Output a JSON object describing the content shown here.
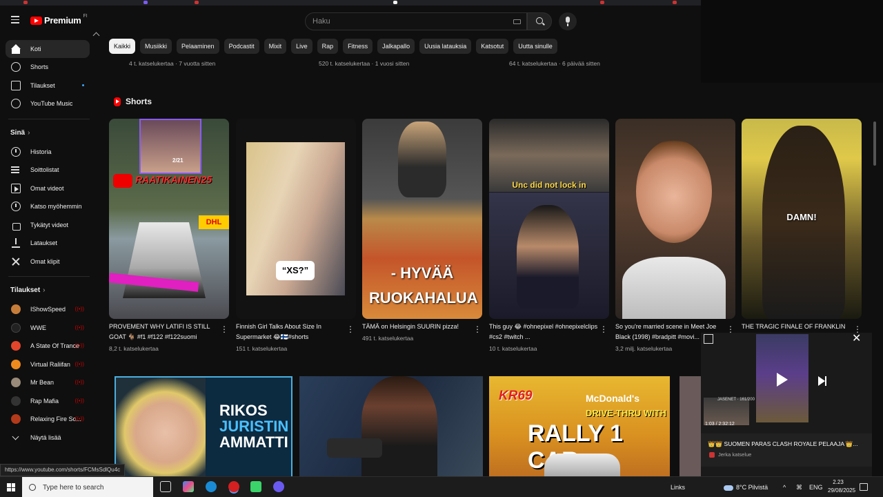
{
  "header": {
    "logo_text": "Premium",
    "logo_sup": "FI",
    "search_placeholder": "Haku"
  },
  "sidebar": {
    "main": [
      {
        "label": "Koti",
        "icon": "home-icon"
      },
      {
        "label": "Shorts",
        "icon": "shorts-icon"
      },
      {
        "label": "Tilaukset",
        "icon": "subscriptions-icon"
      },
      {
        "label": "YouTube Music",
        "icon": "music-icon"
      }
    ],
    "you_title": "Sinä",
    "you": [
      {
        "label": "Historia",
        "icon": "history-icon"
      },
      {
        "label": "Soittolistat",
        "icon": "playlists-icon"
      },
      {
        "label": "Omat videot",
        "icon": "your-videos-icon"
      },
      {
        "label": "Katso myöhemmin",
        "icon": "watch-later-icon"
      },
      {
        "label": "Tykätyt videot",
        "icon": "liked-icon"
      },
      {
        "label": "Lataukset",
        "icon": "downloads-icon"
      },
      {
        "label": "Omat klipit",
        "icon": "clips-icon"
      }
    ],
    "subs_title": "Tilaukset",
    "subs": [
      {
        "label": "IShowSpeed",
        "color": "#c77d3a"
      },
      {
        "label": "WWE",
        "color": "#222222"
      },
      {
        "label": "A State Of Trance",
        "color": "#e4452b"
      },
      {
        "label": "Virtual Raliifan",
        "color": "#f08a1f"
      },
      {
        "label": "Mr Bean",
        "color": "#9a8a7a"
      },
      {
        "label": "Rap Mafia",
        "color": "#333333"
      },
      {
        "label": "Relaxing Fire So...",
        "color": "#b33a1a"
      }
    ],
    "show_more": "Näytä lisää"
  },
  "chips": [
    "Kaikki",
    "Musiikki",
    "Pelaaminen",
    "Podcastit",
    "Mixit",
    "Live",
    "Rap",
    "Fitness",
    "Jalkapallo",
    "Uusia latauksia",
    "Katsotut",
    "Uutta sinulle"
  ],
  "top_meta": [
    "4 t. katselukertaa · 7 vuotta sitten",
    "520 t. katselukertaa · 1 vuosi sitten",
    "64 t. katselukertaa · 6 päivää sitten"
  ],
  "shorts_title": "Shorts",
  "shorts": [
    {
      "title": "PROVEMENT WHY LATIFI IS STILL GOAT 🐐 #f1 #f122 #f122suomi",
      "views": "8,2 t. katselukertaa",
      "overlay": "RAATIKAINEN25",
      "counter": "2/21",
      "tag": "DHL"
    },
    {
      "title": "Finnish Girl Talks About Size In Supermarket 😂🇫🇮#shorts",
      "views": "151 t. katselukertaa",
      "overlay": "“XS?”"
    },
    {
      "title": "TÄMÄ on Helsingin SUURIN pizza!",
      "views": "491 t. katselukertaa",
      "overlay": "- HYVÄÄ RUOKAHALUA"
    },
    {
      "title": "This guy 😂 #ohnepixel #ohnepixelclips #cs2 #twitch ...",
      "views": "10 t. katselukertaa",
      "overlay": "Unc did not lock in"
    },
    {
      "title": "So you're married scene in Meet Joe Black (1998) #bradpitt #movi...",
      "views": "3,2 milj. katselukertaa"
    },
    {
      "title": "THE TRAGIC FINALE OF FRANKLIN",
      "views": "",
      "overlay": "DAMN!"
    }
  ],
  "videos": [
    {
      "overlay1": "RIKOS",
      "overlay2": "JURISTIN",
      "overlay3": "AMMATTI"
    },
    {},
    {
      "logo": "KR69",
      "brand": "McDonald's",
      "line1": "DRIVE-THRU WITH",
      "line2": "RALLY 1 CAR"
    }
  ],
  "miniplayer": {
    "time": "1:03 / 2:32:12",
    "channel_tag": "JASENET · 161/200",
    "title": "👑👑 SUOMEN PARAS CLASH ROYALE PELAAJA 👑...",
    "channel": "Jerka katselue"
  },
  "status_url": "https://www.youtube.com/shorts/FCMsSdlQu4c",
  "taskbar": {
    "search_placeholder": "Type here to search",
    "links": "Links",
    "weather": "8°C Pilvistä",
    "lang": "ENG",
    "time": "2.23",
    "date": "29/08/2025"
  }
}
